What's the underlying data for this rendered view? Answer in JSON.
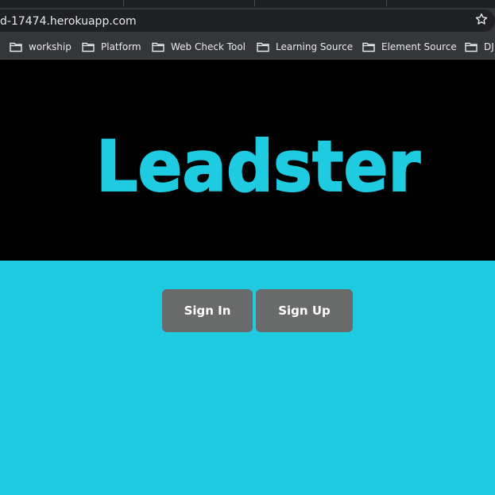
{
  "browser": {
    "url": "d-17474.herokuapp.com",
    "bookmarks": [
      {
        "label": "workship"
      },
      {
        "label": "Platform"
      },
      {
        "label": "Web Check Tool"
      },
      {
        "label": "Learning Source"
      },
      {
        "label": "Element Source"
      },
      {
        "label": "DJ"
      }
    ]
  },
  "hero": {
    "title": "Leadster",
    "title_color": "#1ecbe1",
    "background": "#000000"
  },
  "page": {
    "background": "#1ecbe1",
    "sign_in_label": "Sign In",
    "sign_up_label": "Sign Up",
    "button_color": "#696a6a"
  }
}
